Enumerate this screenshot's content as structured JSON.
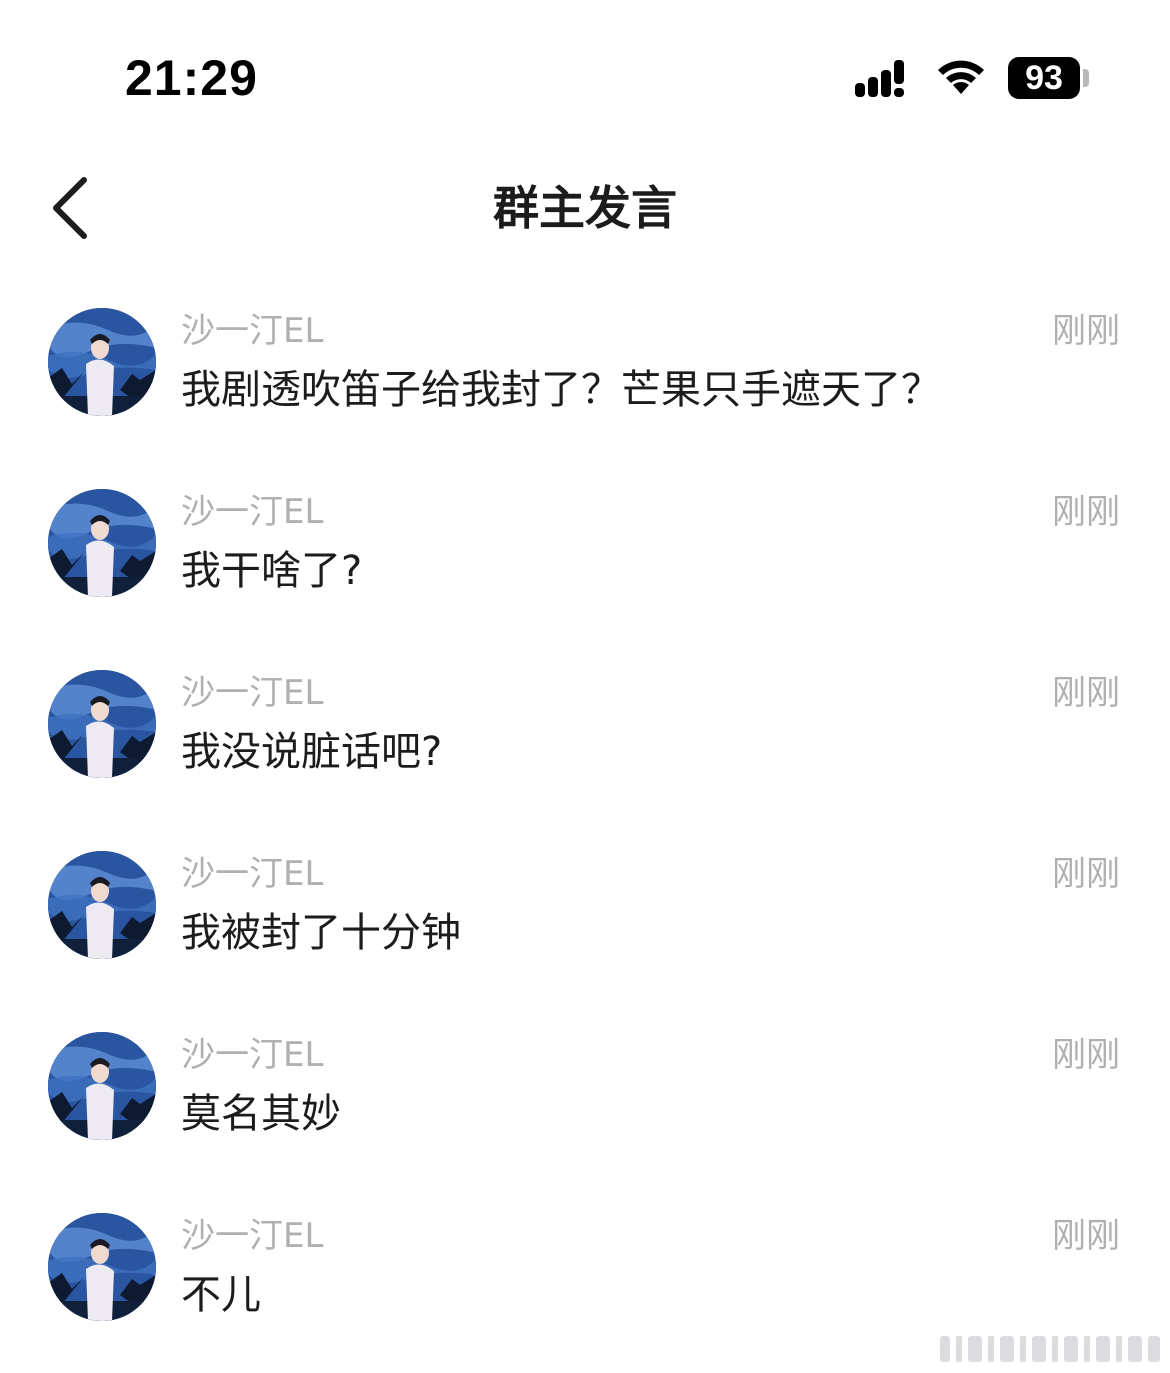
{
  "status_bar": {
    "time": "21:29",
    "battery_level": "93",
    "icons": [
      "signal-icon",
      "wifi-icon",
      "battery-icon"
    ]
  },
  "header": {
    "title": "群主发言",
    "back_icon": "chevron-left-icon"
  },
  "messages": [
    {
      "sender": "沙一汀EL",
      "time": "刚刚",
      "text": "我剧透吹笛子给我封了？芒果只手遮天了？"
    },
    {
      "sender": "沙一汀EL",
      "time": "刚刚",
      "text": "我干啥了?"
    },
    {
      "sender": "沙一汀EL",
      "time": "刚刚",
      "text": "我没说脏话吧?"
    },
    {
      "sender": "沙一汀EL",
      "time": "刚刚",
      "text": "我被封了十分钟"
    },
    {
      "sender": "沙一汀EL",
      "time": "刚刚",
      "text": "莫名其妙"
    },
    {
      "sender": "沙一汀EL",
      "time": "刚刚",
      "text": "不儿"
    }
  ],
  "colors": {
    "text_primary": "#1c1c1e",
    "text_secondary": "#b0b0b3",
    "background": "#ffffff",
    "avatar_blue": "#1f3f7a"
  }
}
